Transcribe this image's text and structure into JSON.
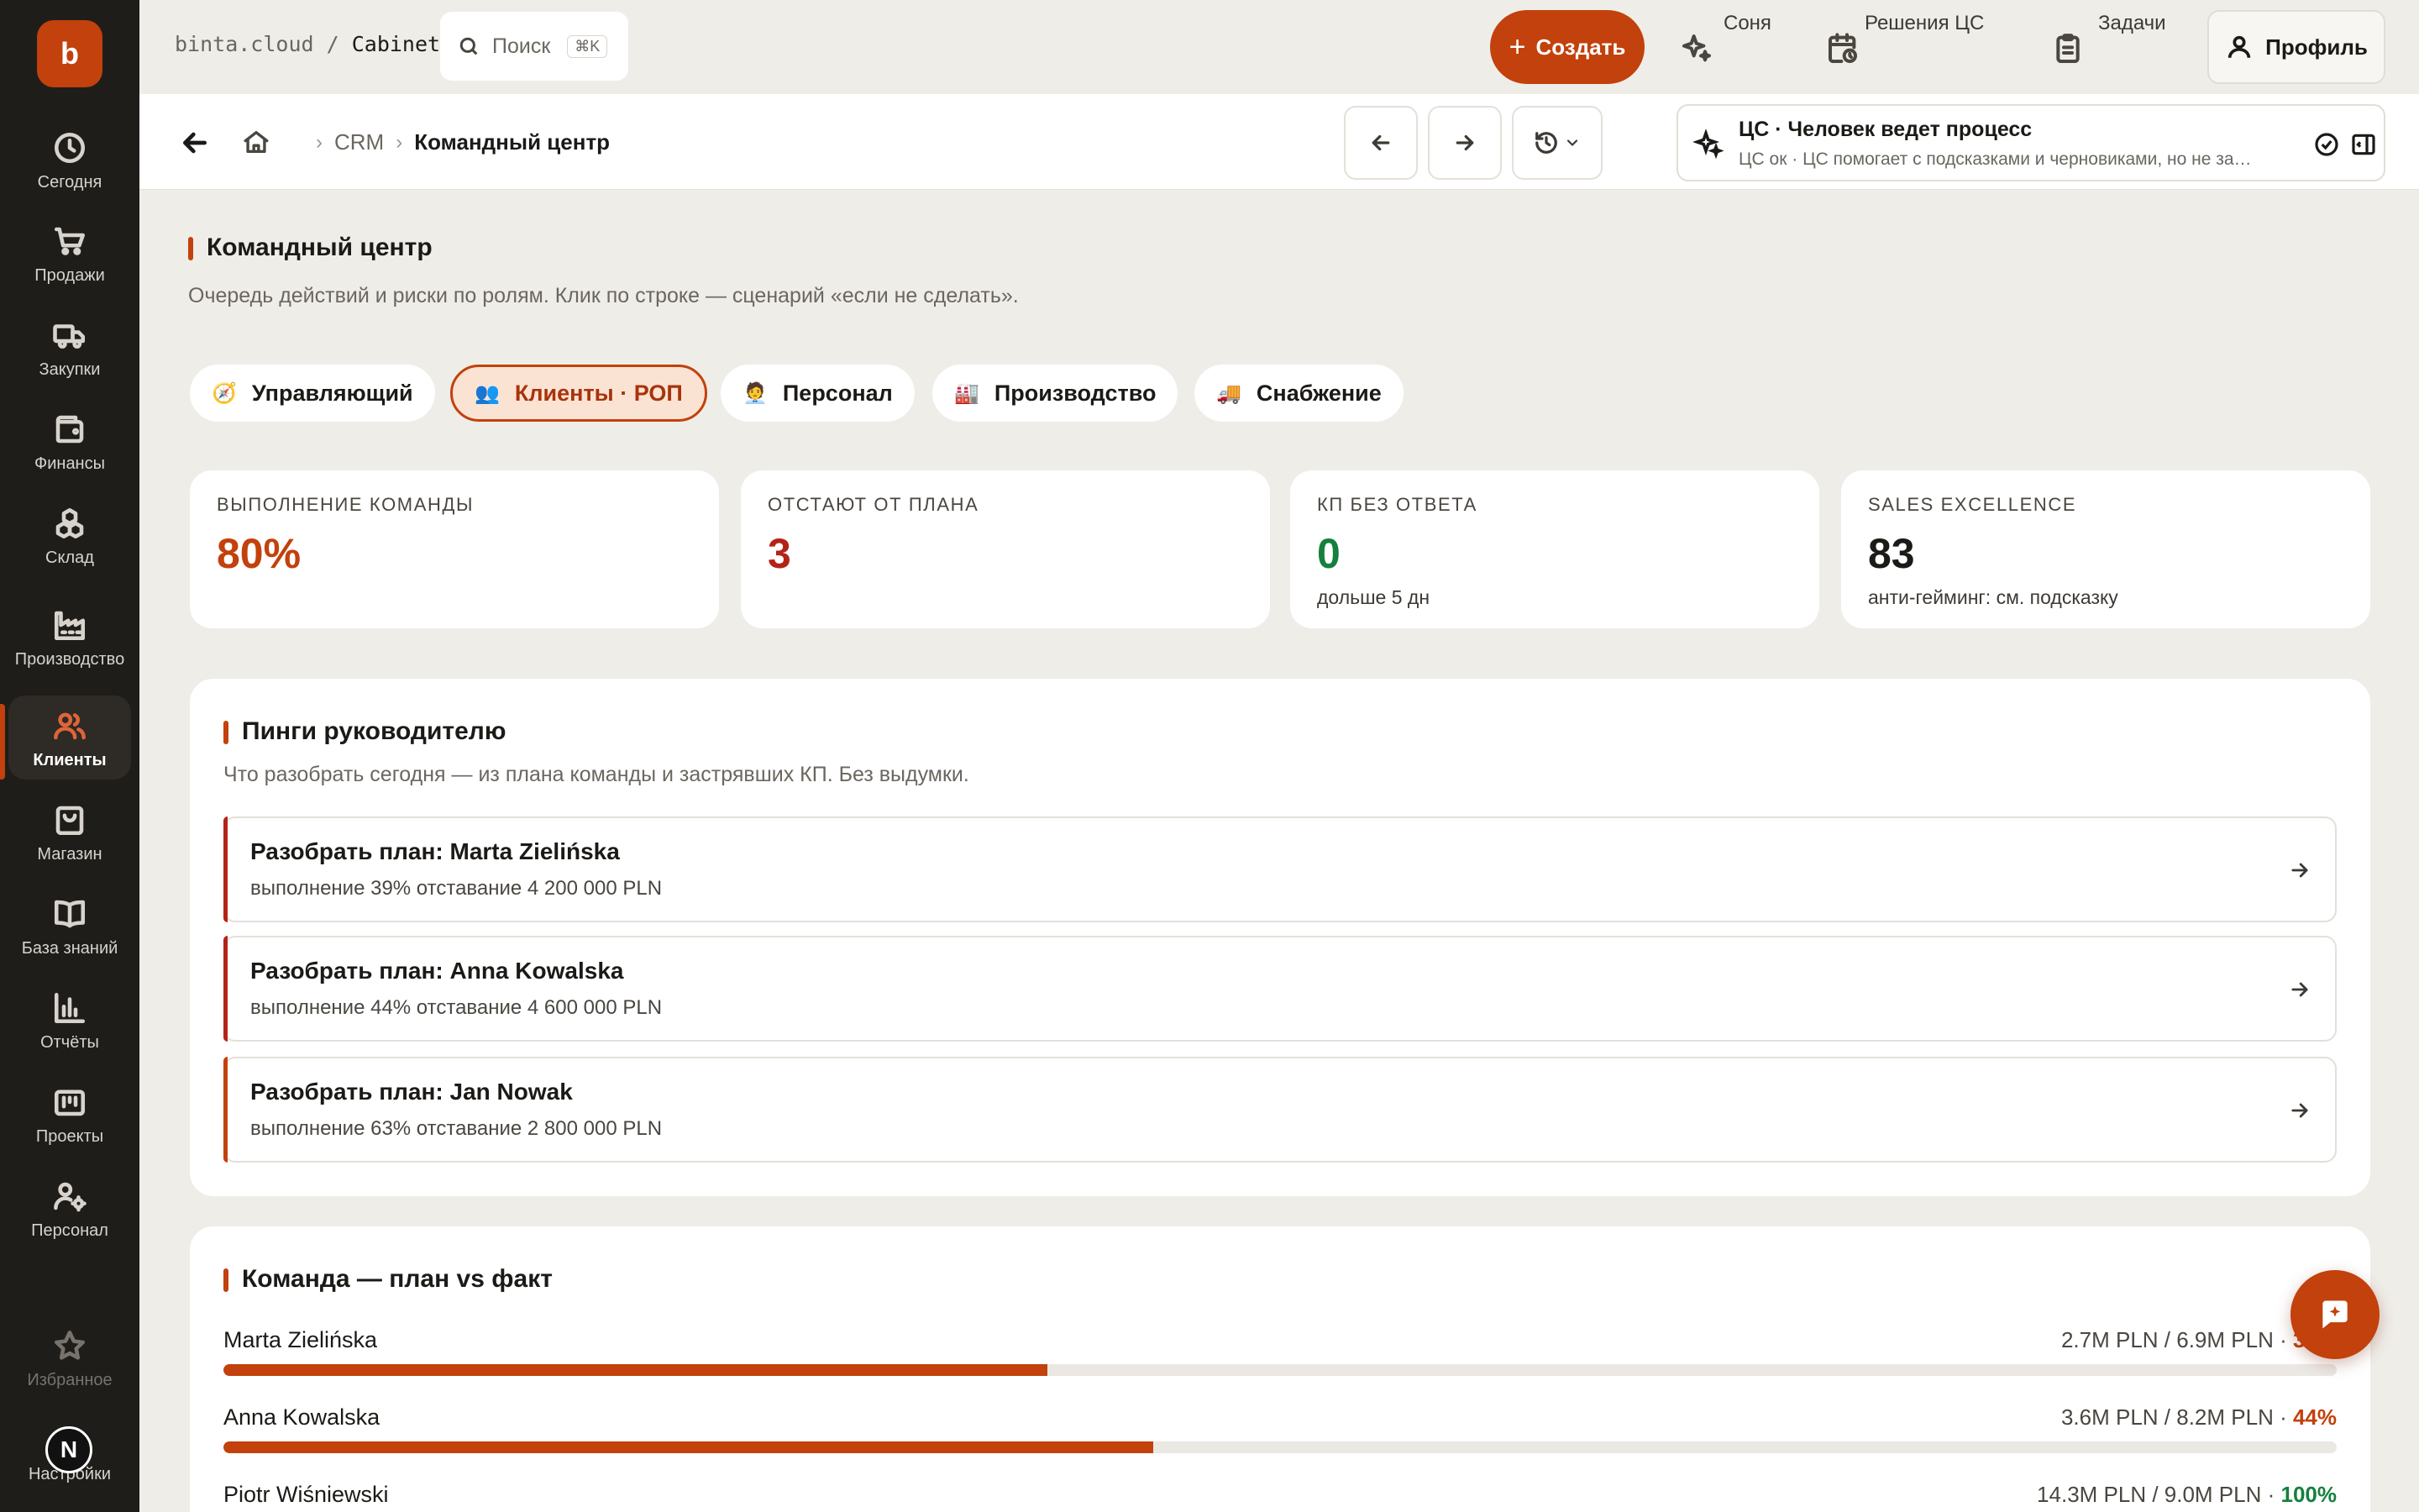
{
  "app": {
    "logo_letter": "b",
    "path_prefix": "binta.cloud / ",
    "path_current": "Cabinet"
  },
  "colors": {
    "accent": "#c2410c",
    "red": "#b42318",
    "green": "#15803d",
    "dark": "#1f1d1a"
  },
  "sidebar": {
    "items": [
      {
        "label": "Сегодня",
        "icon": "clock-icon"
      },
      {
        "label": "Продажи",
        "icon": "cart-icon"
      },
      {
        "label": "Закупки",
        "icon": "truck-icon"
      },
      {
        "label": "Финансы",
        "icon": "wallet-icon"
      },
      {
        "label": "Склад",
        "icon": "boxes-icon"
      },
      {
        "label": "Производство",
        "icon": "factory-icon"
      },
      {
        "label": "Клиенты",
        "icon": "users-icon",
        "active": true
      },
      {
        "label": "Магазин",
        "icon": "bag-icon"
      },
      {
        "label": "База знаний",
        "icon": "book-icon"
      },
      {
        "label": "Отчёты",
        "icon": "chart-icon"
      },
      {
        "label": "Проекты",
        "icon": "folder-icon"
      },
      {
        "label": "Персонал",
        "icon": "user-gear-icon"
      }
    ],
    "favorites": "Избранное",
    "settings": "Настройки",
    "avatar_letter": "N"
  },
  "topbar": {
    "search_placeholder": "Поиск",
    "search_shortcut": "⌘K",
    "create_label": "Создать",
    "sonya": "Соня",
    "decisions": "Решения ЦС",
    "tasks": "Задачи",
    "profile": "Профиль"
  },
  "subbar": {
    "breadcrumb": [
      "CRM",
      "Командный центр"
    ],
    "cs_title": "ЦС · Человек ведет процесс",
    "cs_sub": "ЦС ок · ЦС помогает с подсказками и черновиками, но не за…"
  },
  "page": {
    "title": "Командный центр",
    "subtitle": "Очередь действий и риски по ролям. Клик по строке — сценарий «если не сделать»."
  },
  "roles": [
    {
      "emoji": "🧭",
      "label": "Управляющий",
      "active": false
    },
    {
      "emoji": "👥",
      "label": "Клиенты · РОП",
      "active": true
    },
    {
      "emoji": "🧑‍💼",
      "label": "Персонал",
      "active": false
    },
    {
      "emoji": "🏭",
      "label": "Производство",
      "active": false
    },
    {
      "emoji": "🚚",
      "label": "Снабжение",
      "active": false
    }
  ],
  "kpis": [
    {
      "label": "Выполнение команды",
      "value": "80%",
      "note": "",
      "color": "#c2410c"
    },
    {
      "label": "Отстают от плана",
      "value": "3",
      "note": "",
      "color": "#b42318"
    },
    {
      "label": "КП без ответа",
      "value": "0",
      "note": "дольше 5 дн",
      "color": "#15803d"
    },
    {
      "label": "Sales Excellence",
      "value": "83",
      "note": "анти-гейминг: см. подсказку",
      "color": "#1c1a17"
    }
  ],
  "pings": {
    "title": "Пинги руководителю",
    "subtitle": "Что разобрать сегодня — из плана команды и застрявших КП. Без выдумки.",
    "items": [
      {
        "title": "Разобрать план: Marta Zielińska",
        "note": "выполнение 39% отставание 4 200 000 PLN",
        "color": "#b42318"
      },
      {
        "title": "Разобрать план: Anna Kowalska",
        "note": "выполнение 44% отставание 4 600 000 PLN",
        "color": "#b42318"
      },
      {
        "title": "Разобрать план: Jan Nowak",
        "note": "выполнение 63% отставание 2 800 000 PLN",
        "color": "#c2410c"
      }
    ]
  },
  "team": {
    "title": "Команда — план vs факт",
    "members": [
      {
        "name": "Marta Zielińska",
        "fact": "2.7M PLN / 6.9M PLN · ",
        "pct": "39%",
        "progress": 0.39,
        "pct_color": "#c2410c"
      },
      {
        "name": "Anna Kowalska",
        "fact": "3.6M PLN / 8.2M PLN · ",
        "pct": "44%",
        "progress": 0.44,
        "pct_color": "#c2410c"
      },
      {
        "name": "Piotr Wiśniewski",
        "fact": "14.3M PLN / 9.0M PLN · ",
        "pct": "100%",
        "progress": 1.0,
        "pct_color": "#15803d"
      }
    ]
  }
}
